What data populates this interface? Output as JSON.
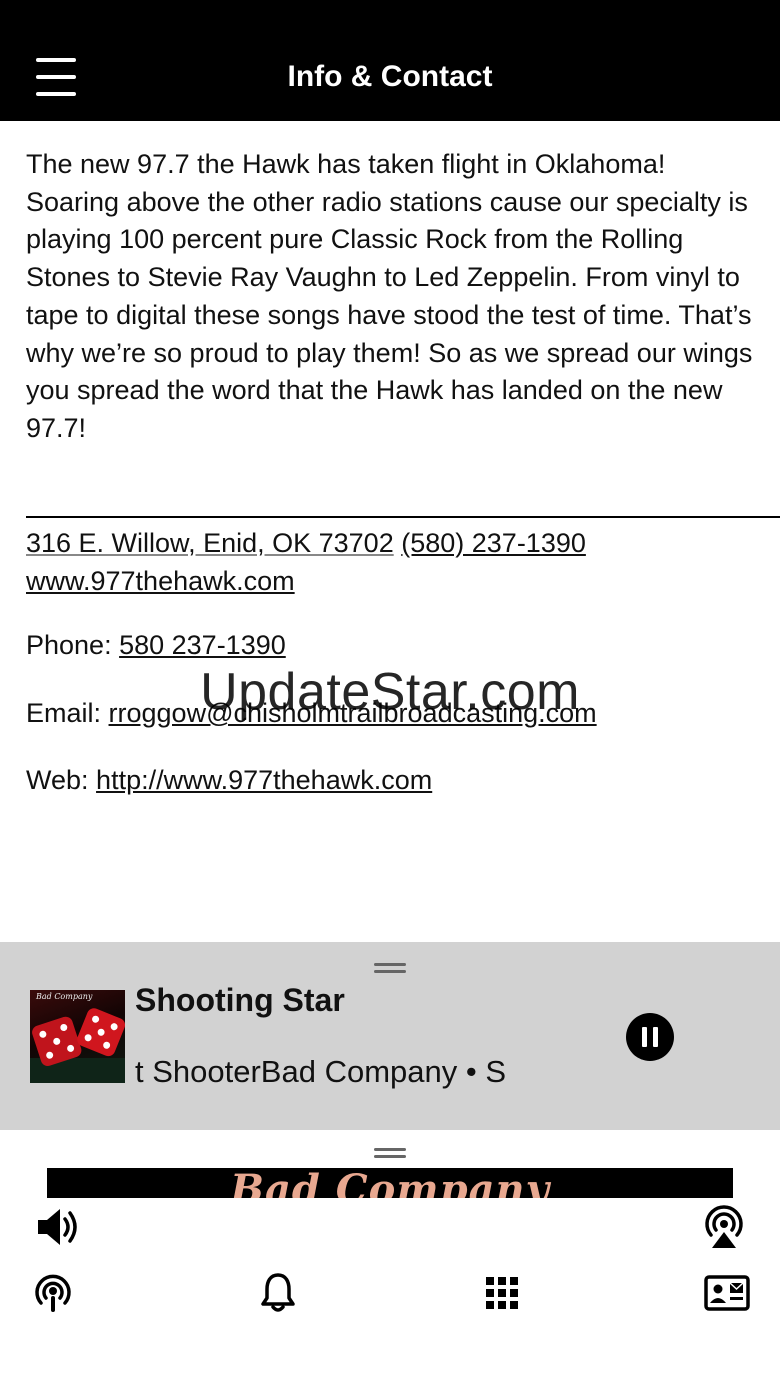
{
  "header": {
    "title": "Info & Contact"
  },
  "about": {
    "text": "The new 97.7 the Hawk has taken flight in Oklahoma! Soaring above the other radio stations cause our specialty is playing 100 percent pure Classic Rock from the Rolling Stones to Stevie Ray Vaughn to Led Zeppelin. From vinyl to tape to digital these songs have stood the test of time. That’s why we’re so proud to play them! So as we spread our wings you spread the word that the Hawk has landed on the new 97.7!"
  },
  "contact": {
    "address": "316 E. Willow, Enid, OK 73702",
    "address_phone": "(580) 237-1390",
    "address_web": "www.977thehawk.com",
    "phone_label": "Phone:",
    "phone": "580 237-1390",
    "email_label": "Email:",
    "email": "rroggow@chisholmtrailbroadcasting.com",
    "web_label": "Web:",
    "web": "http://www.977thehawk.com"
  },
  "watermark": "UpdateStar.com",
  "player": {
    "title": "Shooting Star",
    "meta": "t ShooterBad Company • S",
    "album_art_text": "Bad Company",
    "state": "playing"
  },
  "banner": {
    "text": "Bad Company"
  },
  "icons": {
    "menu": "hamburger-icon",
    "volume": "volume-icon",
    "airplay": "airplay-icon",
    "podcast": "podcast-icon",
    "bell": "bell-icon",
    "grid": "grid-icon",
    "contact_card": "contact-card-icon",
    "pause": "pause-icon"
  },
  "colors": {
    "header_bg": "#000000",
    "player_bg": "#d2d2d2",
    "text": "#111111"
  }
}
